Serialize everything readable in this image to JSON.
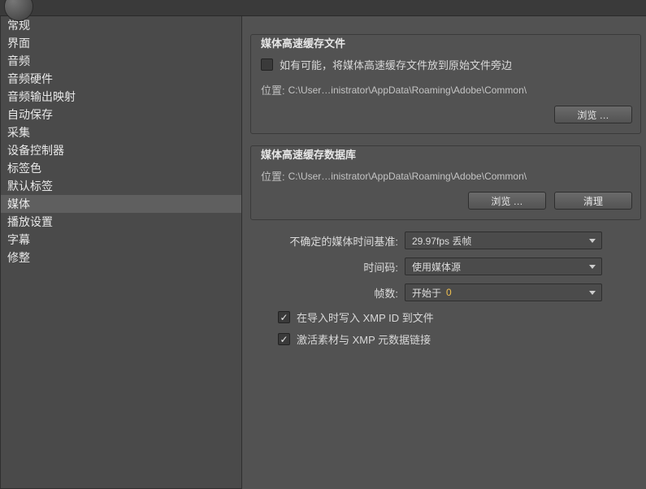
{
  "sidebar": {
    "items": [
      "常规",
      "界面",
      "音频",
      "音频硬件",
      "音频输出映射",
      "自动保存",
      "采集",
      "设备控制器",
      "标签色",
      "默认标签",
      "媒体",
      "播放设置",
      "字幕",
      "修整"
    ],
    "selectedIndex": 10
  },
  "cacheFiles": {
    "title": "媒体高速缓存文件",
    "checkboxLabel": "如有可能，将媒体高速缓存文件放到原始文件旁边",
    "locationLabel": "位置:",
    "locationPath": "C:\\User…inistrator\\AppData\\Roaming\\Adobe\\Common\\",
    "browseLabel": "浏览 …"
  },
  "cacheDb": {
    "title": "媒体高速缓存数据库",
    "locationLabel": "位置:",
    "locationPath": "C:\\User…inistrator\\AppData\\Roaming\\Adobe\\Common\\",
    "browseLabel": "浏览 …",
    "cleanLabel": "清理"
  },
  "form": {
    "timebaseLabel": "不确定的媒体时间基准:",
    "timebaseValue": "29.97fps 丢帧",
    "timecodeLabel": "时间码:",
    "timecodeValue": "使用媒体源",
    "framesLabel": "帧数:",
    "framesPrefix": "开始于",
    "framesValue": "0",
    "xmpWriteLabel": "在导入时写入 XMP ID 到文件",
    "xmpLinkLabel": "激活素材与 XMP 元数据链接"
  }
}
